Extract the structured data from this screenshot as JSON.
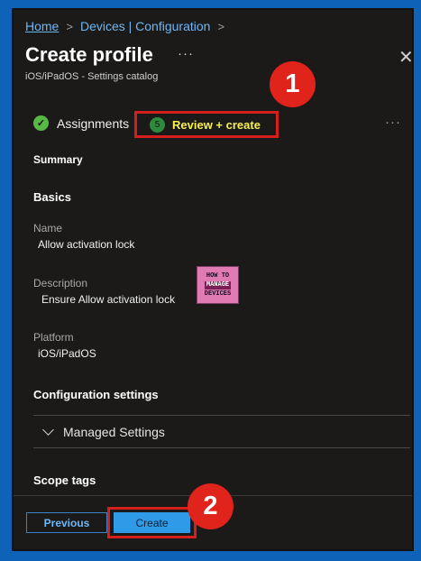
{
  "breadcrumb": {
    "home": "Home",
    "devices": "Devices | Configuration",
    "sep": ">"
  },
  "header": {
    "title": "Create profile",
    "more": "···",
    "close": "✕",
    "subtitle": "iOS/iPadOS - Settings catalog"
  },
  "steps": [
    {
      "label": "Assignments",
      "icon": "check-icon",
      "status": "complete"
    },
    {
      "label": "Review + create",
      "number": "5",
      "status": "current"
    }
  ],
  "steps_more": "···",
  "summary": {
    "heading": "Summary",
    "basics_heading": "Basics",
    "fields": [
      {
        "label": "Name",
        "value": "Allow activation lock"
      },
      {
        "label": "Description",
        "value": "Ensure Allow activation lock"
      },
      {
        "label": "Platform",
        "value": "iOS/iPadOS"
      }
    ],
    "configuration_heading": "Configuration settings",
    "managed_settings": "Managed Settings",
    "scope_tags_heading": "Scope tags"
  },
  "watermark": {
    "line1": "HOW TO",
    "line2": "MANAGE",
    "line3": "DEVICES"
  },
  "footer": {
    "previous_label": "Previous",
    "create_label": "Create"
  },
  "markers": [
    "1",
    "2"
  ],
  "colors": {
    "accent": "#2f9ae8",
    "highlight": "#d41f1f",
    "current_step_text": "#f7ef4e",
    "success": "#58b846",
    "page_bg": "#0e63b8"
  }
}
